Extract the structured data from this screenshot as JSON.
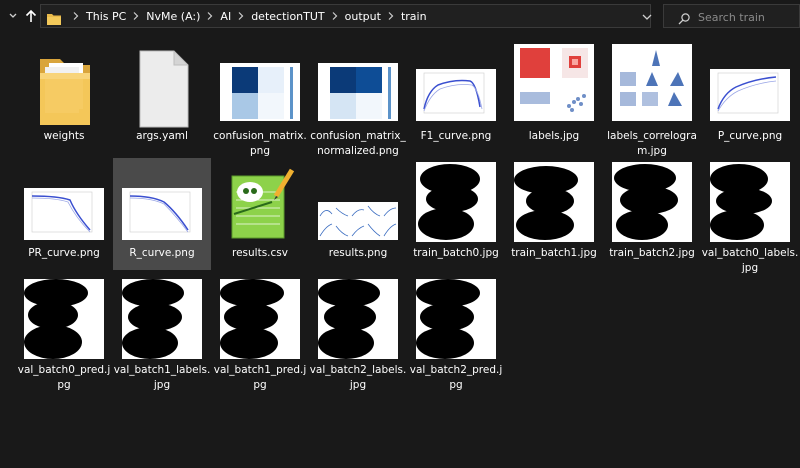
{
  "explorer": {
    "breadcrumbs": [
      "This PC",
      "NvMe (A:)",
      "AI",
      "detectionTUT",
      "output",
      "train"
    ],
    "search_placeholder": "Search train"
  },
  "files": [
    {
      "name": "weights",
      "icon": "folder-icon"
    },
    {
      "name": "args.yaml",
      "icon": "blank-file-icon"
    },
    {
      "name": "confusion_matrix.png",
      "icon": "image-thumbnail"
    },
    {
      "name": "confusion_matrix_normalized.png",
      "icon": "image-thumbnail"
    },
    {
      "name": "F1_curve.png",
      "icon": "image-thumbnail"
    },
    {
      "name": "labels.jpg",
      "icon": "image-thumbnail"
    },
    {
      "name": "labels_correlogram.jpg",
      "icon": "image-thumbnail"
    },
    {
      "name": "P_curve.png",
      "icon": "image-thumbnail"
    },
    {
      "name": "PR_curve.png",
      "icon": "image-thumbnail"
    },
    {
      "name": "R_curve.png",
      "icon": "image-thumbnail",
      "selected": true
    },
    {
      "name": "results.csv",
      "icon": "notepad-plus-plus-icon"
    },
    {
      "name": "results.png",
      "icon": "image-thumbnail"
    },
    {
      "name": "train_batch0.jpg",
      "icon": "image-thumbnail"
    },
    {
      "name": "train_batch1.jpg",
      "icon": "image-thumbnail"
    },
    {
      "name": "train_batch2.jpg",
      "icon": "image-thumbnail"
    },
    {
      "name": "val_batch0_labels.jpg",
      "icon": "image-thumbnail"
    },
    {
      "name": "val_batch0_pred.jpg",
      "icon": "image-thumbnail"
    },
    {
      "name": "val_batch1_labels.jpg",
      "icon": "image-thumbnail"
    },
    {
      "name": "val_batch1_pred.jpg",
      "icon": "image-thumbnail"
    },
    {
      "name": "val_batch2_labels.jpg",
      "icon": "image-thumbnail"
    },
    {
      "name": "val_batch2_pred.jpg",
      "icon": "image-thumbnail"
    }
  ],
  "colors": {
    "background": "#191919",
    "selection": "#4a4a4a",
    "folder": "#e8b94a",
    "confusion_blue": "#0b4a8f"
  }
}
